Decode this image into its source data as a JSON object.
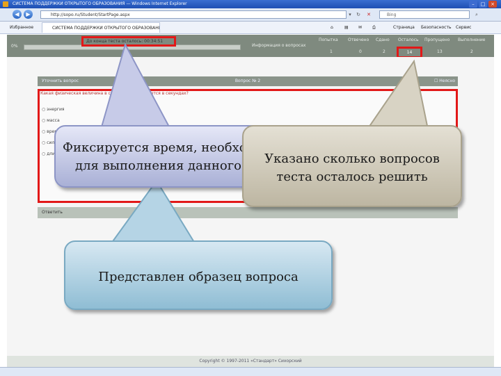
{
  "browser": {
    "title": "СИСТЕМА ПОДДЕРЖКИ ОТКРЫТОГО ОБРАЗОВАНИЯ — Windows Internet Explorer",
    "url": "http://sopo.ru/Student/StartPage.aspx",
    "search_placeholder": "Bing",
    "favorites_label": "Избранное",
    "tab_title": "СИСТЕМА ПОДДЕРЖКИ ОТКРЫТОГО ОБРАЗОВАНИЯ",
    "toolbar_items": [
      "Страница",
      "Безопасность",
      "Сервис"
    ]
  },
  "test_header": {
    "progress_label": "0%",
    "timer_label": "До конца теста осталось: 00:34:51",
    "info_label": "Информация о вопросах",
    "columns": [
      "Попытка",
      "Отвечено",
      "Сдано",
      "Осталось",
      "Пропущено",
      "Выполнение"
    ],
    "values": [
      "1",
      "0",
      "2",
      "14",
      "13",
      "2"
    ]
  },
  "question": {
    "clarify_label": "Уточнить вопрос",
    "title": "Вопрос № 2",
    "unclear_label": "Неясно",
    "text": "Какая физическая величина в системе СИ измеряется в секундах?",
    "options": [
      "энергия",
      "масса",
      "время",
      "сила",
      "длина"
    ]
  },
  "answer_button": "Ответить",
  "footer": "Copyright © 1997-2011 «Стандарт» Сихорский",
  "callouts": [
    {
      "text_line1": "Фиксируется время, необходимое",
      "text_line2": "для выполнения данного теста"
    },
    {
      "text_line1": "Указано сколько вопросов",
      "text_line2": "теста осталось решить"
    },
    {
      "text": "Представлен образец вопроса"
    }
  ]
}
